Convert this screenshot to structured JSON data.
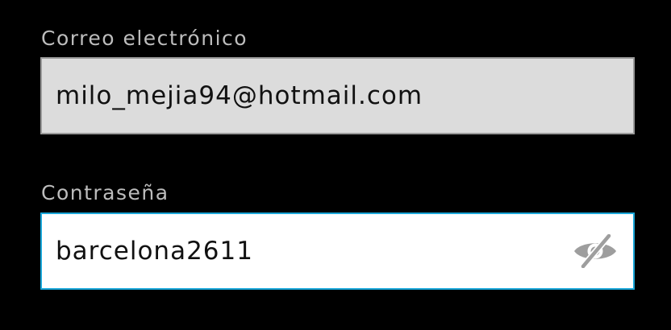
{
  "email": {
    "label": "Correo electrónico",
    "value": "milo_mejia94@hotmail.com"
  },
  "password": {
    "label": "Contraseña",
    "value": "barcelona2611",
    "toggle_icon": "eye-slash-icon"
  },
  "colors": {
    "background": "#000000",
    "label_text": "#bdbdbd",
    "email_fill": "#dcdcdc",
    "email_border": "#9a9a9a",
    "password_border": "#1aa7d9",
    "icon": "#9e9e9e"
  }
}
